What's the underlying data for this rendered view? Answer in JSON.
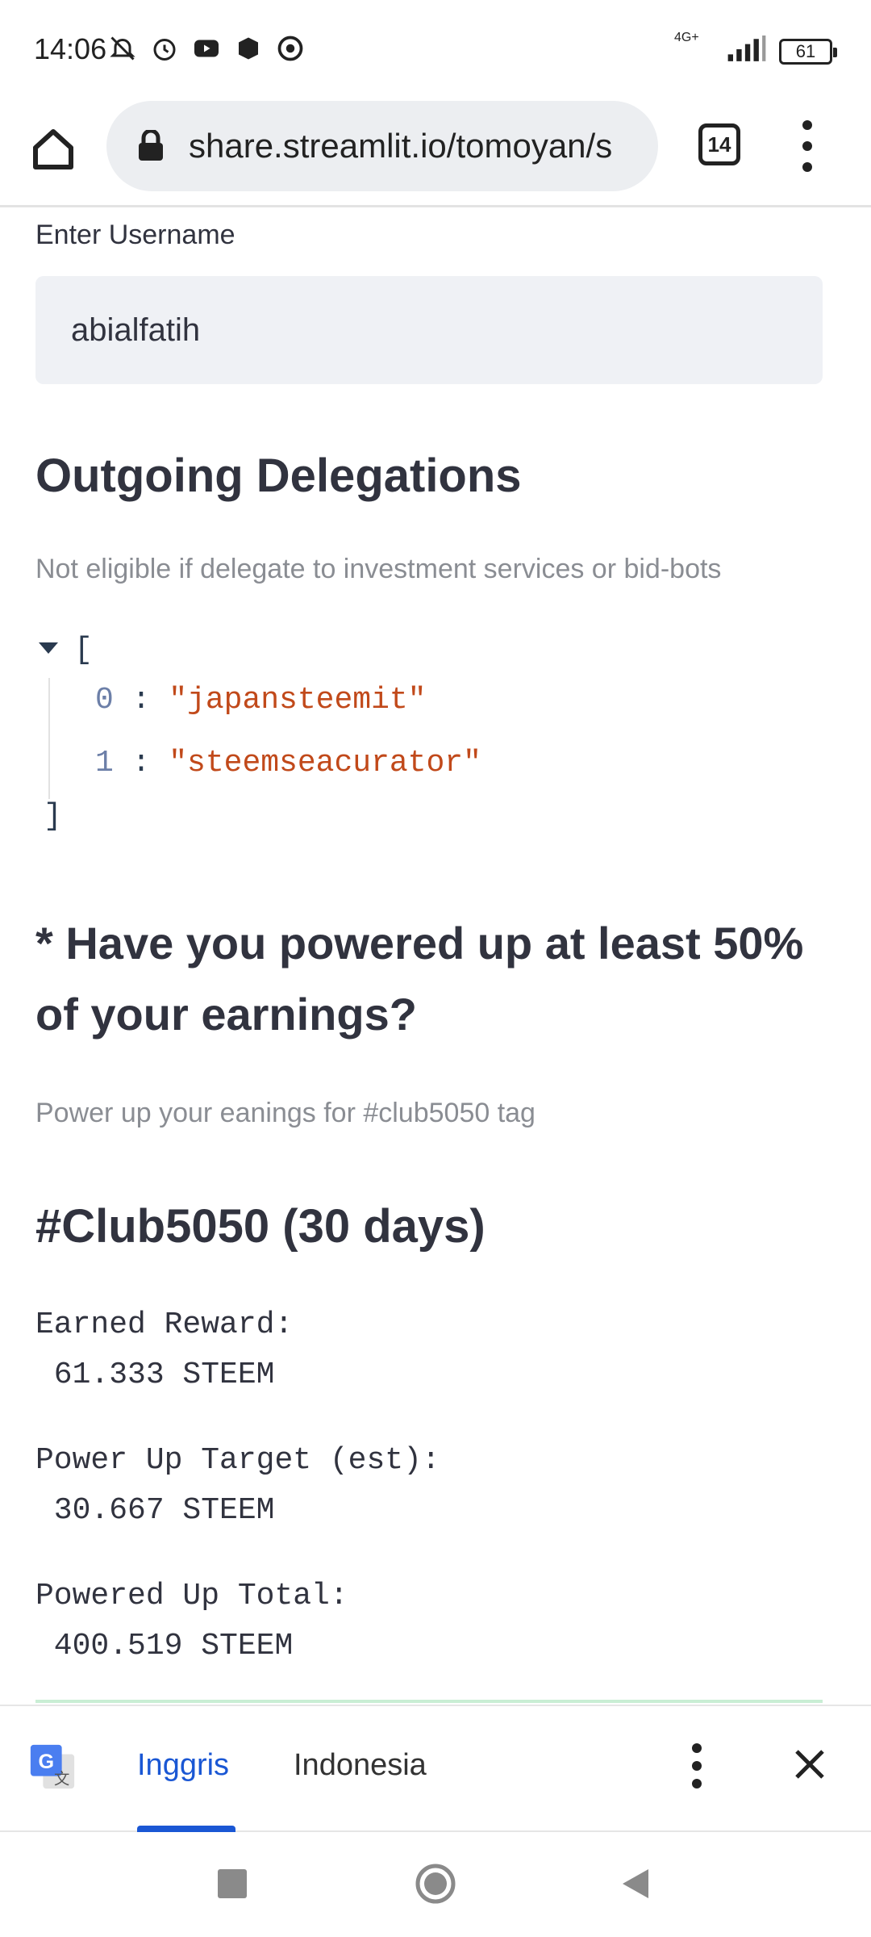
{
  "status_bar": {
    "time": "14:06",
    "network": "4G+",
    "battery": "61"
  },
  "browser": {
    "url": "share.streamlit.io/tomoyan/s",
    "tab_count": "14"
  },
  "form": {
    "username_label": "Enter Username",
    "username_value": "abialfatih"
  },
  "delegations": {
    "heading": "Outgoing Delegations",
    "caption": "Not eligible if delegate to investment services or bid-bots",
    "open_bracket": "[",
    "close_bracket": "]",
    "items": [
      {
        "index": "0",
        "value": "\"japansteemit\""
      },
      {
        "index": "1",
        "value": "\"steemseacurator\""
      }
    ]
  },
  "power_up": {
    "heading_line1": "* Have you powered up at least 50%",
    "heading_line2": "of your earnings?",
    "caption": "Power up your eanings for #club5050 tag"
  },
  "club": {
    "heading": "#Club5050 (30 days)",
    "stats": [
      {
        "label": "Earned Reward:",
        "value": " 61.333 STEEM"
      },
      {
        "label": "Power Up Target (est):",
        "value": " 30.667 STEEM"
      },
      {
        "label": "Powered Up Total:",
        "value": " 400.519 STEEM"
      }
    ]
  },
  "translate_bar": {
    "source_lang": "Inggris",
    "target_lang": "Indonesia"
  },
  "colors": {
    "accent": "#1a57d4",
    "json_string": "#c1491a",
    "caption": "#8a8d93"
  }
}
